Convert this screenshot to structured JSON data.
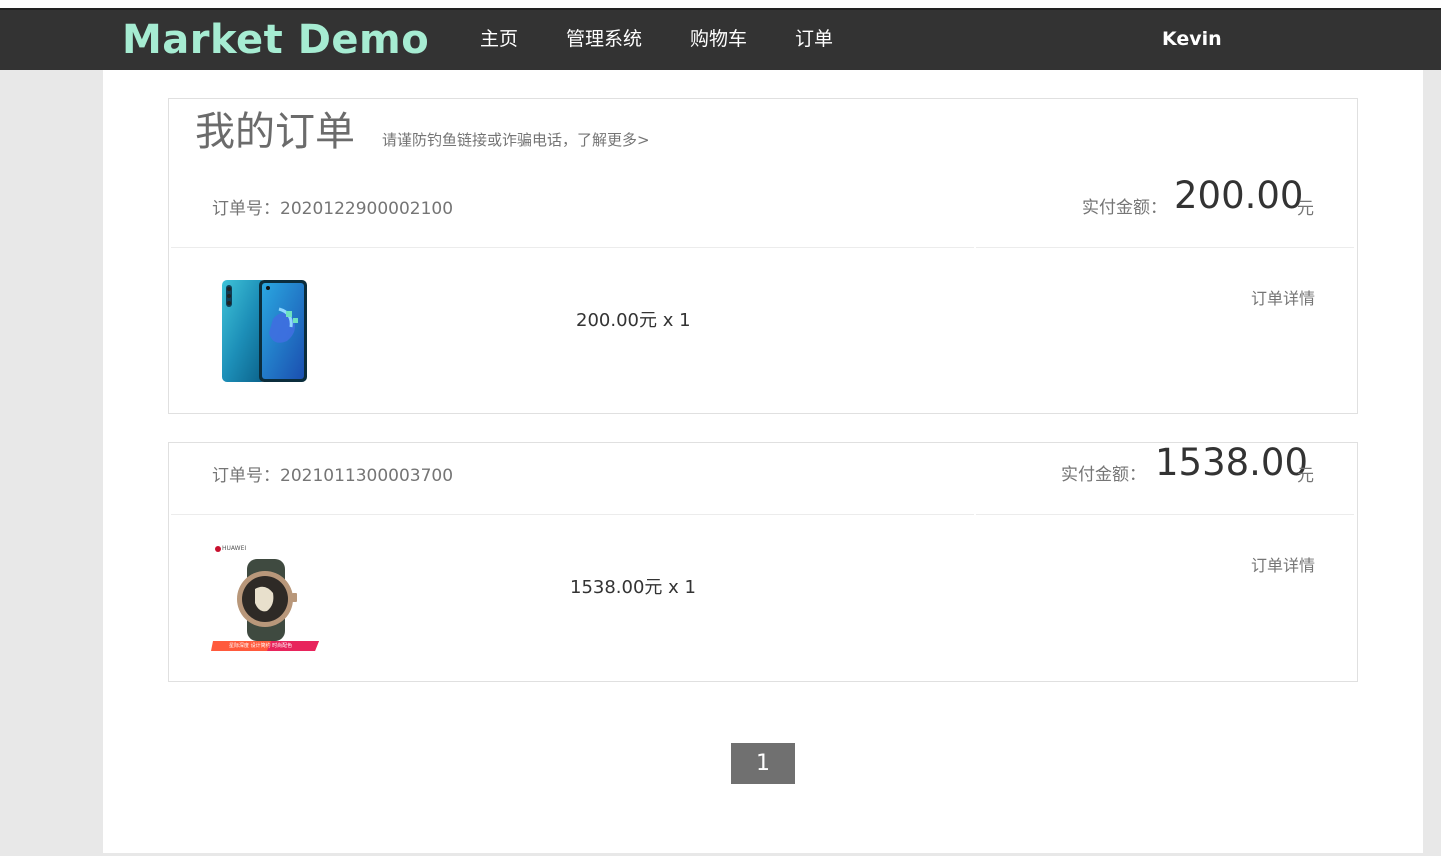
{
  "nav": {
    "brand": "Market Demo",
    "links": [
      "主页",
      "管理系统",
      "购物车",
      "订单"
    ],
    "user": "Kevin"
  },
  "page": {
    "title": "我的订单",
    "notice": "请谨防钓鱼链接或诈骗电话，了解更多>"
  },
  "labels": {
    "order_no_prefix": "订单号：",
    "amount_label": "实付金额：",
    "amount_unit": "元",
    "details": "订单详情"
  },
  "orders": [
    {
      "order_no": "订单号：2020122900002100",
      "amount": "200.00",
      "line": "200.00元 x 1",
      "product_icon": "phone-product-image"
    },
    {
      "order_no": "订单号：2021011300003700",
      "amount": "1538.00",
      "line": "1538.00元 x 1",
      "product_icon": "watch-product-image",
      "product_brand_text": "HUAWEI",
      "product_banner_text": "星际深度 设计简约 时尚配色"
    }
  ],
  "pagination": {
    "current": "1"
  },
  "colors": {
    "navbar": "#333333",
    "brand": "#a6ecd2",
    "background": "#e8e8e8",
    "pager": "#707070"
  }
}
